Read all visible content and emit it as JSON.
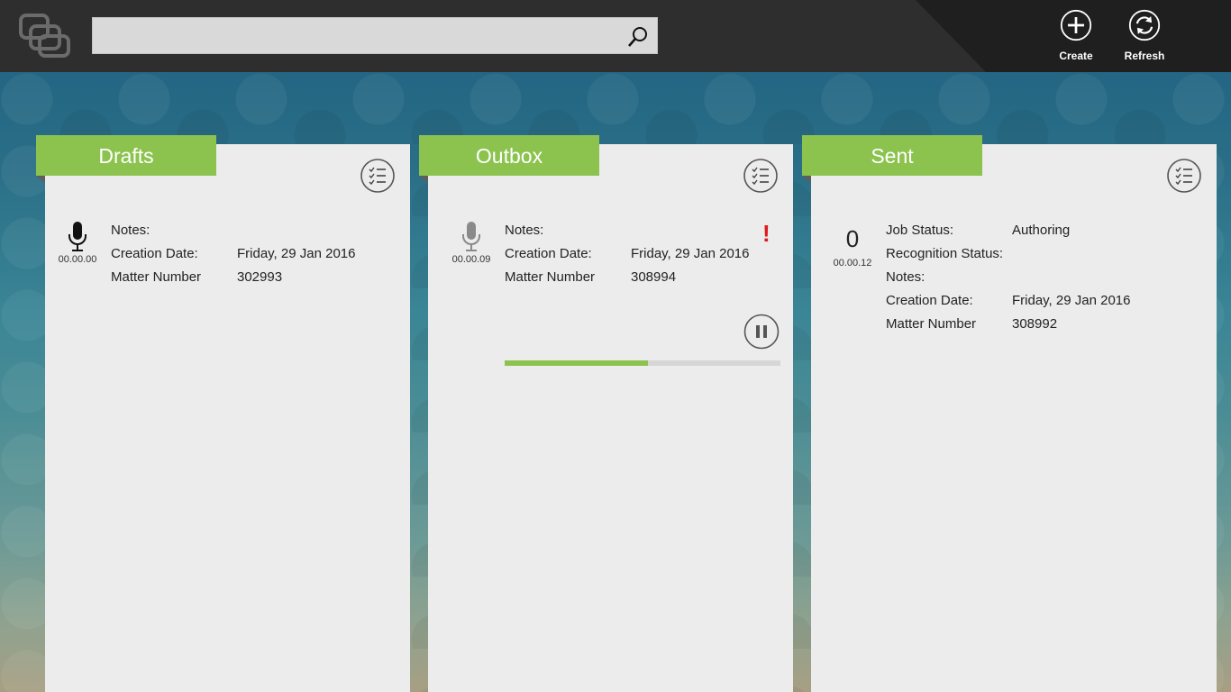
{
  "search": {
    "placeholder": "",
    "value": ""
  },
  "appbar": {
    "create_label": "Create",
    "refresh_label": "Refresh"
  },
  "colors": {
    "accent": "#8cc34f",
    "topbar": "#2e2e2e",
    "alert": "#e0191d"
  },
  "drafts": {
    "title": "Drafts",
    "item": {
      "duration": "00.00.00",
      "notes_label": "Notes:",
      "notes_value": "",
      "date_label": "Creation Date:",
      "date_value": "Friday, 29 Jan 2016",
      "matter_label": "Matter Number",
      "matter_value": "302993"
    }
  },
  "outbox": {
    "title": "Outbox",
    "item": {
      "duration": "00.00.09",
      "notes_label": "Notes:",
      "notes_value": "",
      "date_label": "Creation Date:",
      "date_value": "Friday, 29 Jan 2016",
      "matter_label": "Matter Number",
      "matter_value": "308994",
      "alert": "!",
      "upload_progress": 0.52
    }
  },
  "sent": {
    "title": "Sent",
    "item": {
      "count": "0",
      "duration": "00.00.12",
      "job_status_label": "Job Status:",
      "job_status_value": "Authoring",
      "recognition_label": "Recognition Status:",
      "recognition_value": "",
      "notes_label": "Notes:",
      "notes_value": "",
      "date_label": "Creation Date:",
      "date_value": "Friday, 29 Jan 2016",
      "matter_label": "Matter Number",
      "matter_value": "308992"
    }
  }
}
